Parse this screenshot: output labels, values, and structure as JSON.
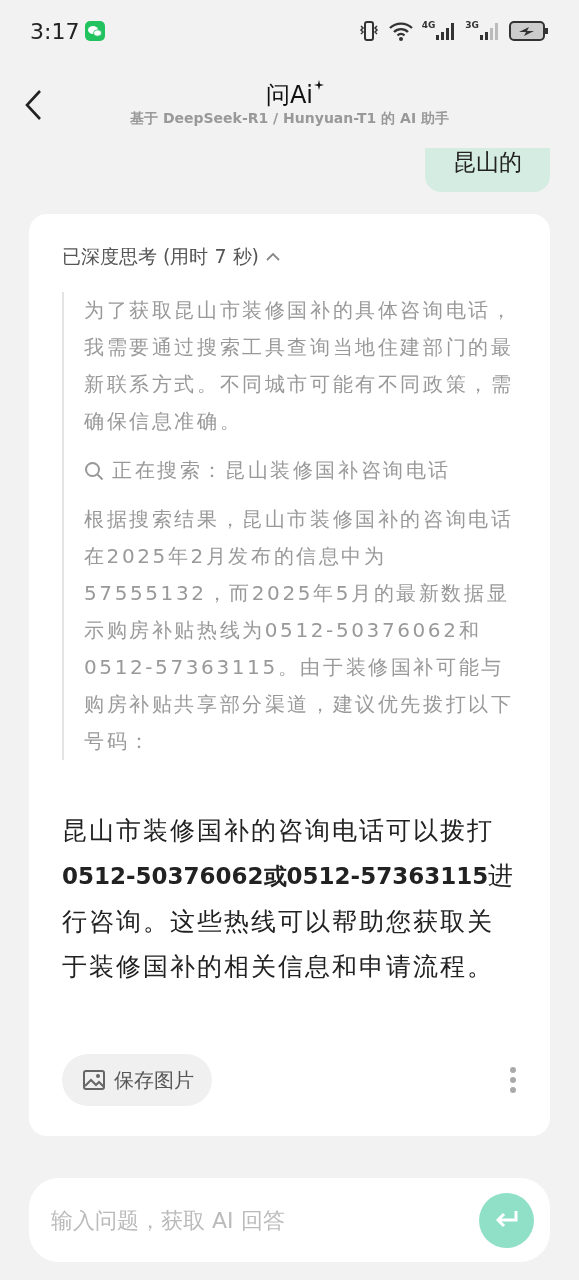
{
  "status_bar": {
    "time": "3:17",
    "network_4g": "4G",
    "network_3g": "3G"
  },
  "header": {
    "title": "问Ai",
    "subtitle": "基于 DeepSeek-R1 / Hunyuan-T1 的 AI 助手"
  },
  "user_message": {
    "text": "昆山的"
  },
  "reply": {
    "thinking_label": "已深度思考 (用时 7 秒)",
    "thinking_expanded": true,
    "thoughts": [
      {
        "kind": "text",
        "text": "为了获取昆山市装修国补的具体咨询电话，我需要通过搜索工具查询当地住建部门的最新联系方式。不同城市可能有不同政策，需确保信息准确。"
      },
      {
        "kind": "search",
        "text": "正在搜索：昆山装修国补咨询电话"
      },
      {
        "kind": "text",
        "text": "根据搜索结果，昆山市装修国补的咨询电话在2025年2月发布的信息中为57555132，而2025年5月的最新数据显示购房补贴热线为0512-50376062和0512-57363115。由于装修国补可能与购房补贴共享部分渠道，建议优先拨打以下号码："
      }
    ],
    "answer": "昆山市装修国补的咨询电话可以拨打**0512-50376062或0512-57363115**进行咨询。这些热线可以帮助您获取关于装修国补的相关信息和申请流程。",
    "save_button": "保存图片"
  },
  "input": {
    "placeholder": "输入问题，获取 AI 回答"
  }
}
